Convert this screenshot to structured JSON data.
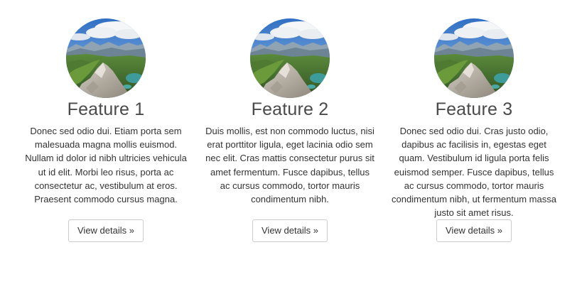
{
  "features": [
    {
      "title": "Feature 1",
      "description": "Donec sed odio dui. Etiam porta sem malesuada magna mollis euismod. Nullam id dolor id nibh ultricies vehicula ut id elit. Morbi leo risus, porta ac consectetur ac, vestibulum at eros. Praesent commodo cursus magna.",
      "button_label": "View details »",
      "image_alt": "mountain-landscape-photo"
    },
    {
      "title": "Feature 2",
      "description": "Duis mollis, est non commodo luctus, nisi erat porttitor ligula, eget lacinia odio sem nec elit. Cras mattis consectetur purus sit amet fermentum. Fusce dapibus, tellus ac cursus commodo, tortor mauris condimentum nibh.",
      "button_label": "View details »",
      "image_alt": "mountain-landscape-photo"
    },
    {
      "title": "Feature 3",
      "description": "Donec sed odio dui. Cras justo odio, dapibus ac facilisis in, egestas eget quam. Vestibulum id ligula porta felis euismod semper. Fusce dapibus, tellus ac cursus commodo, tortor mauris condimentum nibh, ut fermentum massa justo sit amet risus.",
      "button_label": "View details »",
      "image_alt": "mountain-landscape-photo"
    }
  ],
  "colors": {
    "title": "#4a4a4a",
    "text": "#333333",
    "button_border": "#cccccc",
    "sky": "#4f8fd6",
    "cloud": "#f4f6f8",
    "mountain_far": "#8fa3b3",
    "forest": "#3f6b2c",
    "rock": "#b9b3aa",
    "lake": "#3d9c9a"
  }
}
